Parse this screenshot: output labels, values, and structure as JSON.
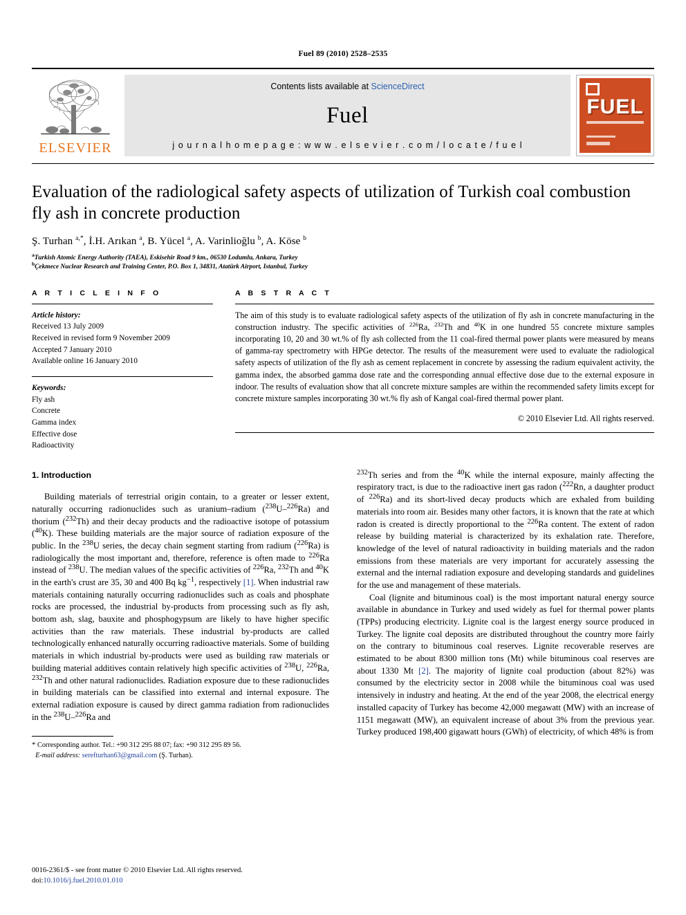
{
  "running_head": "Fuel 89 (2010) 2528–2535",
  "journal_header": {
    "publisher_name": "ELSEVIER",
    "contents_prefix": "Contents lists available at ",
    "contents_link": "ScienceDirect",
    "journal_name": "Fuel",
    "homepage": "j o u r n a l   h o m e p a g e :   w w w . e l s e v i e r . c o m / l o c a t e / f u e l",
    "cover_title": "FUEL",
    "accent_orange": "#E87722",
    "cover_orange": "#CE4D23",
    "link_blue": "#2b5fb3"
  },
  "article": {
    "title": "Evaluation of the radiological safety aspects of utilization of Turkish coal combustion fly ash in concrete production",
    "authors_html": "Ş. Turhan <sup>a,*</sup>, İ.H. Arıkan <sup>a</sup>, B. Yücel <sup>a</sup>, A. Varinlioğlu <sup>b</sup>, A. Köse <sup>b</sup>",
    "affiliations": [
      "Turkish Atomic Energy Authority (TAEA), Eskisehir Road 9 km., 06530 Lodumlu, Ankara, Turkey",
      "Çekmece Nuclear Research and Training Center, P.O. Box 1, 34831, Atatürk Airport, Istanbul, Turkey"
    ],
    "affiliation_marks": [
      "a",
      "b"
    ]
  },
  "article_info": {
    "heading": "A R T I C L E  I N F O",
    "history_label": "Article history:",
    "history": [
      "Received 13 July 2009",
      "Received in revised form 9 November 2009",
      "Accepted 7 January 2010",
      "Available online 16 January 2010"
    ],
    "keywords_label": "Keywords:",
    "keywords": [
      "Fly ash",
      "Concrete",
      "Gamma index",
      "Effective dose",
      "Radioactivity"
    ]
  },
  "abstract": {
    "heading": "A B S T R A C T",
    "body_html": "The aim of this study is to evaluate radiological safety aspects of the utilization of fly ash in concrete manufacturing in the construction industry. The specific activities of <sup>226</sup>Ra, <sup>232</sup>Th and <sup>40</sup>K in one hundred 55 concrete mixture samples incorporating 10, 20 and 30 wt.% of fly ash collected from the 11 coal-fired thermal power plants were measured by means of gamma-ray spectrometry with HPGe detector. The results of the measurement were used to evaluate the radiological safety aspects of utilization of the fly ash as cement replacement in concrete by assessing the radium equivalent activity, the gamma index, the absorbed gamma dose rate and the corresponding annual effective dose due to the external exposure in indoor. The results of evaluation show that all concrete mixture samples are within the recommended safety limits except for concrete mixture samples incorporating 30 wt.% fly ash of Kangal coal-fired thermal power plant.",
    "copyright": "© 2010 Elsevier Ltd. All rights reserved."
  },
  "introduction": {
    "heading": "1. Introduction",
    "left_paragraph_html": "Building materials of terrestrial origin contain, to a greater or lesser extent, naturally occurring radionuclides such as uranium–radium (<sup>238</sup>U–<sup>226</sup>Ra) and thorium (<sup>232</sup>Th) and their decay products and the radioactive isotope of potassium (<sup>40</sup>K). These building materials are the major source of radiation exposure of the public. In the <sup>238</sup>U series, the decay chain segment starting from radium (<sup>226</sup>Ra) is radiologically the most important and, therefore, reference is often made to <sup>226</sup>Ra instead of <sup>238</sup>U. The median values of the specific activities of <sup>226</sup>Ra, <sup>232</sup>Th and <sup>40</sup>K in the earth's crust are 35, 30 and 400 Bq kg<sup>−1</sup>, respectively <span class=\"ref\">[1]</span>. When industrial raw materials containing naturally occurring radionuclides such as coals and phosphate rocks are processed, the industrial by-products from processing such as fly ash, bottom ash, slag, bauxite and phosphogypsum are likely to have higher specific activities than the raw materials. These industrial by-products are called technologically enhanced naturally occurring radioactive materials. Some of building materials in which industrial by-products were used as building raw materials or building material additives contain relatively high specific activities of <sup>238</sup>U, <sup>226</sup>Ra, <sup>232</sup>Th and other natural radionuclides. Radiation exposure due to these radionuclides in building materials can be classified into external and internal exposure. The external radiation exposure is caused by direct gamma radiation from radionuclides in the <sup>238</sup>U–<sup>226</sup>Ra and",
    "right_paragraph_1_html": "<sup>232</sup>Th series and from the <sup>40</sup>K while the internal exposure, mainly affecting the respiratory tract, is due to the radioactive inert gas radon (<sup>222</sup>Rn, a daughter product of <sup>226</sup>Ra) and its short-lived decay products which are exhaled from building materials into room air. Besides many other factors, it is known that the rate at which radon is created is directly proportional to the <sup>226</sup>Ra content. The extent of radon release by building material is characterized by its exhalation rate. Therefore, knowledge of the level of natural radioactivity in building materials and the radon emissions from these materials are very important for accurately assessing the external and the internal radiation exposure and developing standards and guidelines for the use and management of these materials.",
    "right_paragraph_2_html": "Coal (lignite and bituminous coal) is the most important natural energy source available in abundance in Turkey and used widely as fuel for thermal power plants (TPPs) producing electricity. Lignite coal is the largest energy source produced in Turkey. The lignite coal deposits are distributed throughout the country more fairly on the contrary to bituminous coal reserves. Lignite recoverable reserves are estimated to be about 8300 million tons (Mt) while bituminous coal reserves are about 1330 Mt <span class=\"ref\">[2]</span>. The majority of lignite coal production (about 82%) was consumed by the electricity sector in 2008 while the bituminous coal was used intensively in industry and heating. At the end of the year 2008, the electrical energy installed capacity of Turkey has become 42,000 megawatt (MW) with an increase of 1151 megawatt (MW), an equivalent increase of about 3% from the previous year. Turkey produced 198,400 gigawatt hours (GWh) of electricity, of which 48% is from"
  },
  "footnote": {
    "star": "*",
    "corresponding_html": "Corresponding author. Tel.: +90 312 295 88 07; fax: +90 312 295 89 56.",
    "email_label": "E-mail address:",
    "email": "serefturhan63@gmail.com",
    "email_suffix": "(Ş. Turhan)."
  },
  "page_footer": {
    "issn_line": "0016-2361/$ - see front matter © 2010 Elsevier Ltd. All rights reserved.",
    "doi_label": "doi:",
    "doi_value": "10.1016/j.fuel.2010.01.010"
  }
}
